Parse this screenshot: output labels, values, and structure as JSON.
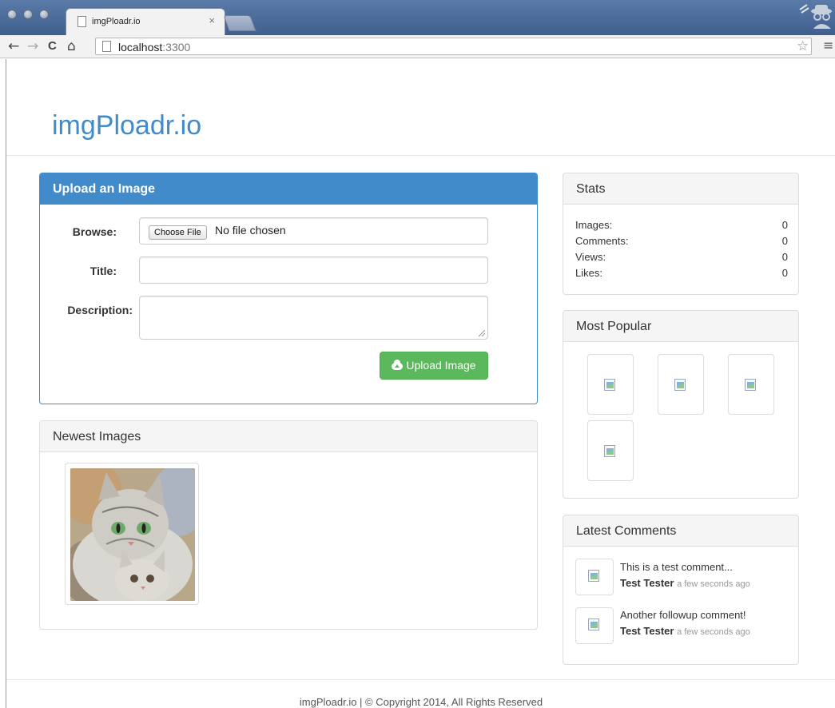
{
  "browser": {
    "tab_title": "imgPloadr.io",
    "tab_close": "×",
    "url_host": "localhost",
    "url_port": ":3300",
    "nav": {
      "back": "←",
      "forward": "→",
      "reload": "C",
      "home": "⌂"
    },
    "star": "☆",
    "menu": "≡"
  },
  "site": {
    "brand": "imgPloadr.io",
    "footer": "imgPloadr.io | © Copyright 2014, All Rights Reserved"
  },
  "upload": {
    "heading": "Upload an Image",
    "browse_label": "Browse:",
    "choose_file": "Choose File",
    "file_status": "No file chosen",
    "title_label": "Title:",
    "title_value": "",
    "description_label": "Description:",
    "description_value": "",
    "submit": "Upload Image"
  },
  "newest": {
    "heading": "Newest Images"
  },
  "stats": {
    "heading": "Stats",
    "rows": [
      {
        "label": "Images:",
        "value": "0"
      },
      {
        "label": "Comments:",
        "value": "0"
      },
      {
        "label": "Views:",
        "value": "0"
      },
      {
        "label": "Likes:",
        "value": "0"
      }
    ]
  },
  "popular": {
    "heading": "Most Popular"
  },
  "comments": {
    "heading": "Latest Comments",
    "items": [
      {
        "text": "This is a test comment...",
        "author": "Test Tester",
        "time": "a few seconds ago"
      },
      {
        "text": "Another followup comment!",
        "author": "Test Tester",
        "time": "a few seconds ago"
      }
    ]
  },
  "colors": {
    "primary": "#428bca",
    "success": "#5cb85c",
    "chrome": "#4a6a98"
  }
}
